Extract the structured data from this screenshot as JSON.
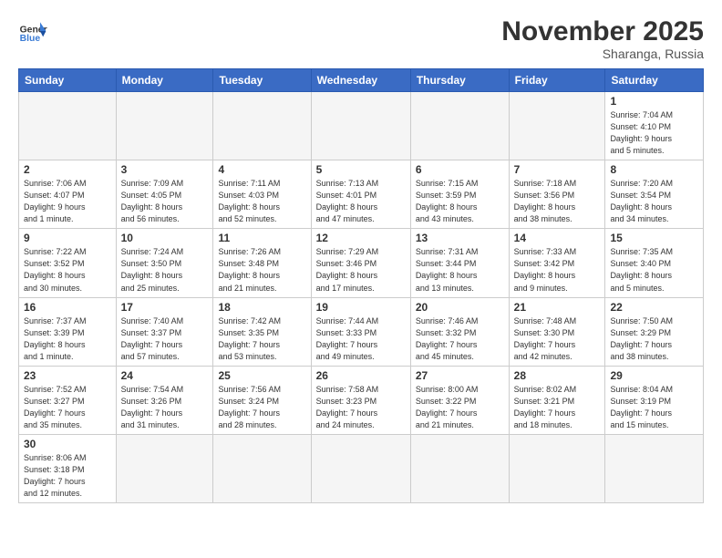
{
  "logo": {
    "text_general": "General",
    "text_blue": "Blue"
  },
  "header": {
    "month": "November 2025",
    "location": "Sharanga, Russia"
  },
  "weekdays": [
    "Sunday",
    "Monday",
    "Tuesday",
    "Wednesday",
    "Thursday",
    "Friday",
    "Saturday"
  ],
  "days": [
    {
      "num": "",
      "info": "",
      "empty": true
    },
    {
      "num": "",
      "info": "",
      "empty": true
    },
    {
      "num": "",
      "info": "",
      "empty": true
    },
    {
      "num": "",
      "info": "",
      "empty": true
    },
    {
      "num": "",
      "info": "",
      "empty": true
    },
    {
      "num": "",
      "info": "",
      "empty": true
    },
    {
      "num": "1",
      "info": "Sunrise: 7:04 AM\nSunset: 4:10 PM\nDaylight: 9 hours\nand 5 minutes.",
      "empty": false
    },
    {
      "num": "2",
      "info": "Sunrise: 7:06 AM\nSunset: 4:07 PM\nDaylight: 9 hours\nand 1 minute.",
      "empty": false
    },
    {
      "num": "3",
      "info": "Sunrise: 7:09 AM\nSunset: 4:05 PM\nDaylight: 8 hours\nand 56 minutes.",
      "empty": false
    },
    {
      "num": "4",
      "info": "Sunrise: 7:11 AM\nSunset: 4:03 PM\nDaylight: 8 hours\nand 52 minutes.",
      "empty": false
    },
    {
      "num": "5",
      "info": "Sunrise: 7:13 AM\nSunset: 4:01 PM\nDaylight: 8 hours\nand 47 minutes.",
      "empty": false
    },
    {
      "num": "6",
      "info": "Sunrise: 7:15 AM\nSunset: 3:59 PM\nDaylight: 8 hours\nand 43 minutes.",
      "empty": false
    },
    {
      "num": "7",
      "info": "Sunrise: 7:18 AM\nSunset: 3:56 PM\nDaylight: 8 hours\nand 38 minutes.",
      "empty": false
    },
    {
      "num": "8",
      "info": "Sunrise: 7:20 AM\nSunset: 3:54 PM\nDaylight: 8 hours\nand 34 minutes.",
      "empty": false
    },
    {
      "num": "9",
      "info": "Sunrise: 7:22 AM\nSunset: 3:52 PM\nDaylight: 8 hours\nand 30 minutes.",
      "empty": false
    },
    {
      "num": "10",
      "info": "Sunrise: 7:24 AM\nSunset: 3:50 PM\nDaylight: 8 hours\nand 25 minutes.",
      "empty": false
    },
    {
      "num": "11",
      "info": "Sunrise: 7:26 AM\nSunset: 3:48 PM\nDaylight: 8 hours\nand 21 minutes.",
      "empty": false
    },
    {
      "num": "12",
      "info": "Sunrise: 7:29 AM\nSunset: 3:46 PM\nDaylight: 8 hours\nand 17 minutes.",
      "empty": false
    },
    {
      "num": "13",
      "info": "Sunrise: 7:31 AM\nSunset: 3:44 PM\nDaylight: 8 hours\nand 13 minutes.",
      "empty": false
    },
    {
      "num": "14",
      "info": "Sunrise: 7:33 AM\nSunset: 3:42 PM\nDaylight: 8 hours\nand 9 minutes.",
      "empty": false
    },
    {
      "num": "15",
      "info": "Sunrise: 7:35 AM\nSunset: 3:40 PM\nDaylight: 8 hours\nand 5 minutes.",
      "empty": false
    },
    {
      "num": "16",
      "info": "Sunrise: 7:37 AM\nSunset: 3:39 PM\nDaylight: 8 hours\nand 1 minute.",
      "empty": false
    },
    {
      "num": "17",
      "info": "Sunrise: 7:40 AM\nSunset: 3:37 PM\nDaylight: 7 hours\nand 57 minutes.",
      "empty": false
    },
    {
      "num": "18",
      "info": "Sunrise: 7:42 AM\nSunset: 3:35 PM\nDaylight: 7 hours\nand 53 minutes.",
      "empty": false
    },
    {
      "num": "19",
      "info": "Sunrise: 7:44 AM\nSunset: 3:33 PM\nDaylight: 7 hours\nand 49 minutes.",
      "empty": false
    },
    {
      "num": "20",
      "info": "Sunrise: 7:46 AM\nSunset: 3:32 PM\nDaylight: 7 hours\nand 45 minutes.",
      "empty": false
    },
    {
      "num": "21",
      "info": "Sunrise: 7:48 AM\nSunset: 3:30 PM\nDaylight: 7 hours\nand 42 minutes.",
      "empty": false
    },
    {
      "num": "22",
      "info": "Sunrise: 7:50 AM\nSunset: 3:29 PM\nDaylight: 7 hours\nand 38 minutes.",
      "empty": false
    },
    {
      "num": "23",
      "info": "Sunrise: 7:52 AM\nSunset: 3:27 PM\nDaylight: 7 hours\nand 35 minutes.",
      "empty": false
    },
    {
      "num": "24",
      "info": "Sunrise: 7:54 AM\nSunset: 3:26 PM\nDaylight: 7 hours\nand 31 minutes.",
      "empty": false
    },
    {
      "num": "25",
      "info": "Sunrise: 7:56 AM\nSunset: 3:24 PM\nDaylight: 7 hours\nand 28 minutes.",
      "empty": false
    },
    {
      "num": "26",
      "info": "Sunrise: 7:58 AM\nSunset: 3:23 PM\nDaylight: 7 hours\nand 24 minutes.",
      "empty": false
    },
    {
      "num": "27",
      "info": "Sunrise: 8:00 AM\nSunset: 3:22 PM\nDaylight: 7 hours\nand 21 minutes.",
      "empty": false
    },
    {
      "num": "28",
      "info": "Sunrise: 8:02 AM\nSunset: 3:21 PM\nDaylight: 7 hours\nand 18 minutes.",
      "empty": false
    },
    {
      "num": "29",
      "info": "Sunrise: 8:04 AM\nSunset: 3:19 PM\nDaylight: 7 hours\nand 15 minutes.",
      "empty": false
    },
    {
      "num": "30",
      "info": "Sunrise: 8:06 AM\nSunset: 3:18 PM\nDaylight: 7 hours\nand 12 minutes.",
      "empty": false
    },
    {
      "num": "",
      "info": "",
      "empty": true
    },
    {
      "num": "",
      "info": "",
      "empty": true
    },
    {
      "num": "",
      "info": "",
      "empty": true
    },
    {
      "num": "",
      "info": "",
      "empty": true
    },
    {
      "num": "",
      "info": "",
      "empty": true
    },
    {
      "num": "",
      "info": "",
      "empty": true
    }
  ]
}
